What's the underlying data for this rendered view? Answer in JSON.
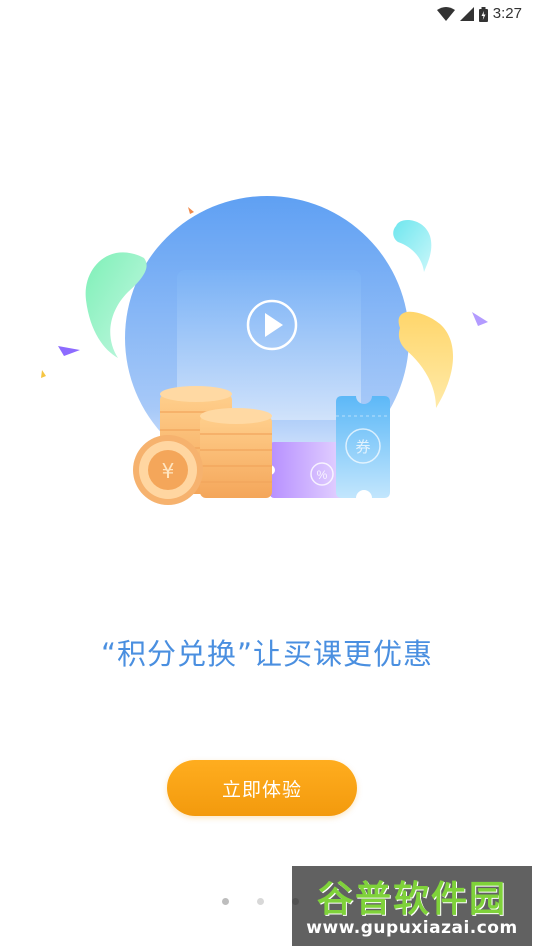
{
  "status_bar": {
    "time": "3:27",
    "icons": [
      "wifi-icon",
      "signal-icon",
      "battery-icon"
    ]
  },
  "illustration": {
    "coin_symbol": "¥",
    "coupon_symbol": "%",
    "ticket_symbol": "券"
  },
  "main": {
    "headline": "“积分兑换”让买课更优惠",
    "cta_label": "立即体验"
  },
  "pager": {
    "dots": 3,
    "active_index": 0
  },
  "watermark": {
    "title": "谷普软件园",
    "url": "www.gupuxiazai.com"
  },
  "colors": {
    "headline": "#4a8fe0",
    "cta": "#f39a0d",
    "circle": "#6fa9f5"
  }
}
